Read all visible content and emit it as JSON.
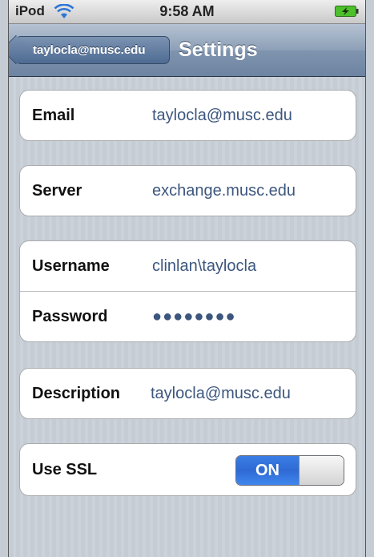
{
  "status_bar": {
    "carrier": "iPod",
    "time": "9:58 AM",
    "wifi_icon": "wifi-icon",
    "battery_icon": "battery-charging-icon"
  },
  "nav_bar": {
    "back_label": "taylocla@musc.edu",
    "title": "Settings"
  },
  "groups": {
    "email": {
      "label": "Email",
      "value": "taylocla@musc.edu"
    },
    "server": {
      "label": "Server",
      "value": "exchange.musc.edu"
    },
    "username": {
      "label": "Username",
      "value": "clinlan\\taylocla"
    },
    "password": {
      "label": "Password",
      "value": "●●●●●●●●"
    },
    "description": {
      "label": "Description",
      "value": "taylocla@musc.edu"
    },
    "ssl": {
      "label": "Use SSL",
      "toggle_label": "ON",
      "state": "on"
    }
  },
  "colors": {
    "nav_bar": "#7f94ae",
    "value_text": "#3c567e",
    "toggle_on": "#3a7de6",
    "background": "#c5ccd4"
  }
}
